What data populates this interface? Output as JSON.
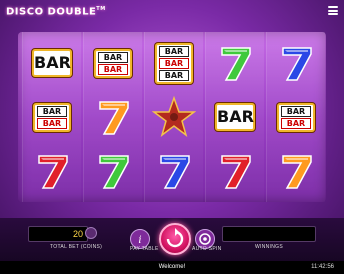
{
  "header": {
    "logo_text": "DISCO DOUBLE",
    "logo_tm": "TM",
    "menu_icon": "hamburger-menu-icon"
  },
  "reels": [
    [
      "BAR",
      "BARx2",
      "7-red"
    ],
    [
      "BARx2",
      "7-orange",
      "7-green"
    ],
    [
      "BARx3",
      "STAR",
      "7-blue"
    ],
    [
      "7-green",
      "BAR",
      "7-red"
    ],
    [
      "7-blue",
      "BARx2",
      "7-orange"
    ]
  ],
  "symbols": {
    "bar_label": "BAR",
    "colors": {
      "red": "#e1202a",
      "orange": "#ff9a1f",
      "green": "#40c93c",
      "blue": "#2a48e6",
      "star": "#b32a1e"
    }
  },
  "controls": {
    "total_bet_value": "20",
    "total_bet_label": "TOTAL BET (COINS)",
    "paytable_label": "PAY TABLE",
    "autospin_label": "AUTO SPIN",
    "winnings_label": "WINNINGS",
    "winnings_value": "",
    "spin_icon": "spin-icon",
    "info_icon": "info-icon",
    "autospin_icon": "autospin-icon"
  },
  "status": {
    "message": "Welcome!",
    "time": "11:42:56"
  }
}
